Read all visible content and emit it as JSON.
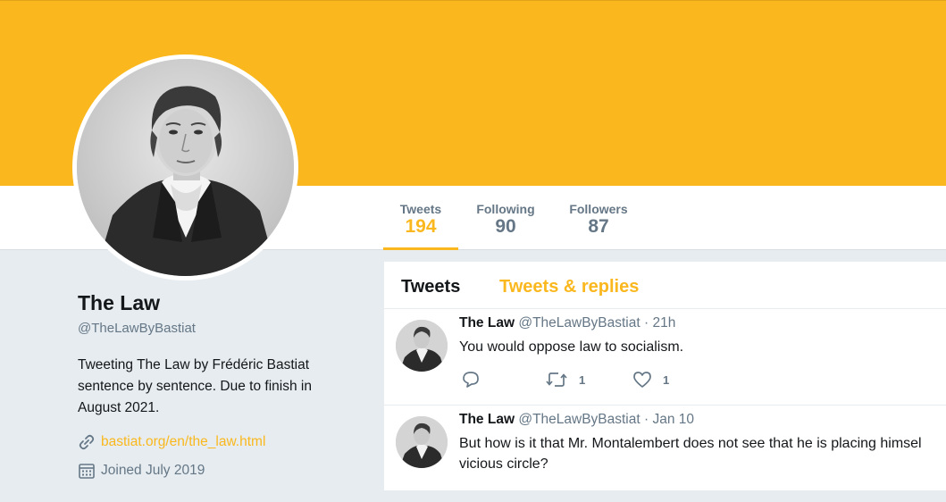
{
  "profile": {
    "name": "The Law",
    "handle": "@TheLawByBastiat",
    "bio": "Tweeting The Law by Frédéric Bastiat sentence by sentence. Due to finish in August 2021.",
    "website": "bastiat.org/en/the_law.html",
    "joined": "Joined July 2019"
  },
  "stats": [
    {
      "label": "Tweets",
      "value": "194",
      "active": true
    },
    {
      "label": "Following",
      "value": "90",
      "active": false
    },
    {
      "label": "Followers",
      "value": "87",
      "active": false
    }
  ],
  "tabs": {
    "tweets": "Tweets",
    "replies": "Tweets & replies"
  },
  "tweets": [
    {
      "name": "The Law",
      "meta": "@TheLawByBastiat · 21h",
      "text": "You would oppose law to socialism.",
      "retweets": "1",
      "likes": "1"
    },
    {
      "name": "The Law",
      "meta": "@TheLawByBastiat · Jan 10",
      "text": "But how is it that Mr. Montalembert does not see that he is placing himself in a vicious circle?",
      "text_line1": "But how is it that Mr. Montalembert does not see that he is placing himsel",
      "text_line2": "vicious circle?",
      "retweets": "",
      "likes": ""
    }
  ],
  "colors": {
    "accent": "#fab81e",
    "muted": "#657786",
    "text": "#14171a",
    "page_bg": "#e6ecf0"
  },
  "icons": {
    "link": "link-icon",
    "calendar": "calendar-icon",
    "reply": "reply-icon",
    "retweet": "retweet-icon",
    "like": "heart-icon"
  }
}
